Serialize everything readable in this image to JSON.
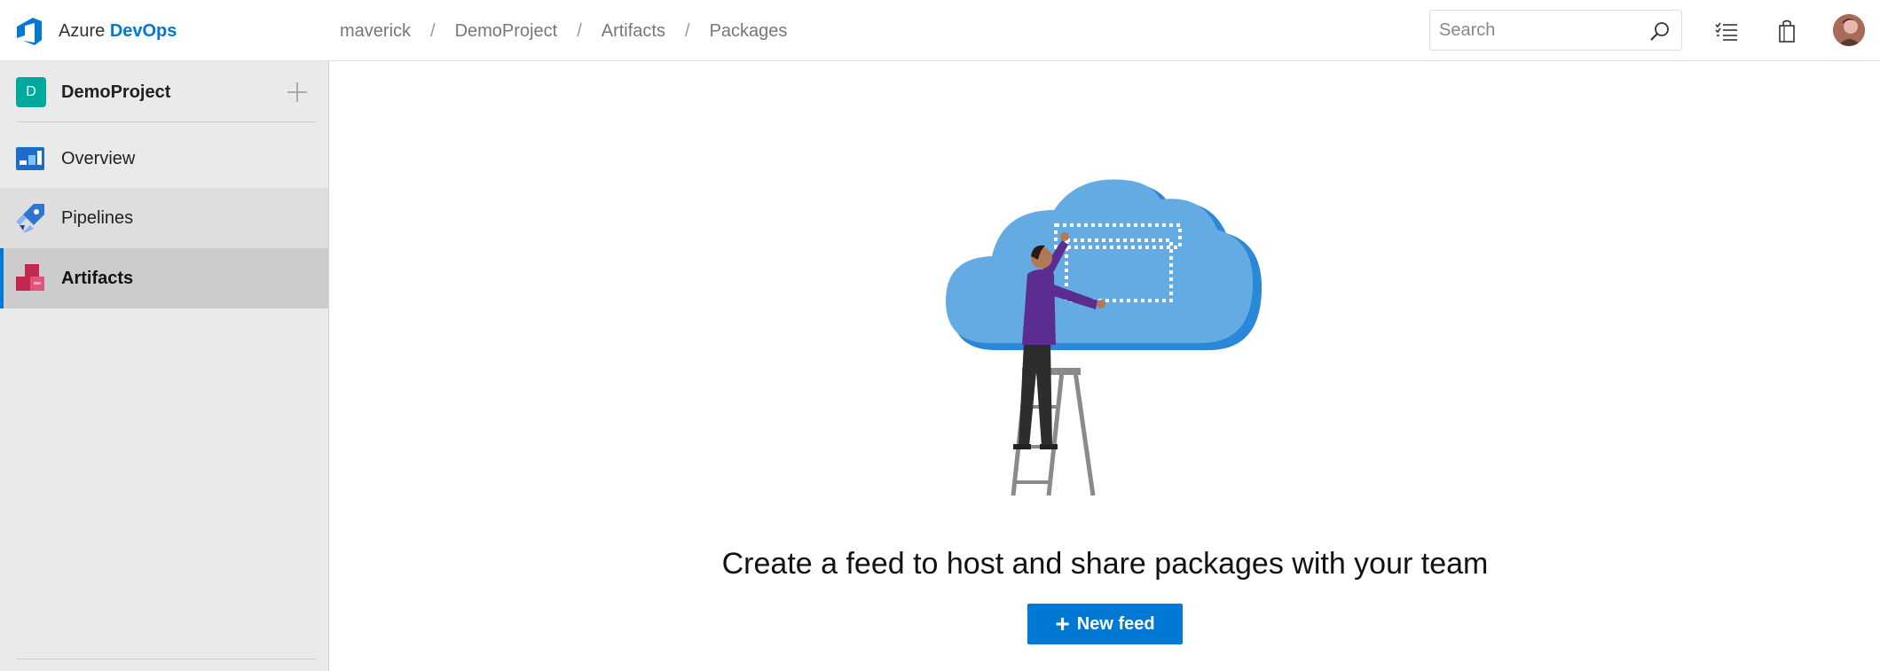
{
  "brand": {
    "prefix": "Azure",
    "accent": "DevOps"
  },
  "breadcrumb": [
    "maverick",
    "DemoProject",
    "Artifacts",
    "Packages"
  ],
  "search": {
    "placeholder": "Search"
  },
  "top_icons": [
    "search-icon",
    "work-items-icon",
    "marketplace-bag-icon",
    "user-avatar"
  ],
  "sidebar": {
    "project": {
      "initial": "D",
      "name": "DemoProject"
    },
    "items": [
      {
        "label": "Overview",
        "icon": "overview-icon"
      },
      {
        "label": "Pipelines",
        "icon": "pipelines-icon"
      },
      {
        "label": "Artifacts",
        "icon": "artifacts-icon",
        "active": true
      }
    ]
  },
  "main": {
    "headline": "Create a feed to host and share packages with your team",
    "new_feed_label": "New feed"
  },
  "colors": {
    "accent": "#0078d4",
    "project_badge": "#00a99d",
    "sidebar_bg": "#eaeaea",
    "active_item_bg": "#cccccc",
    "cloud": "#64abe3"
  }
}
